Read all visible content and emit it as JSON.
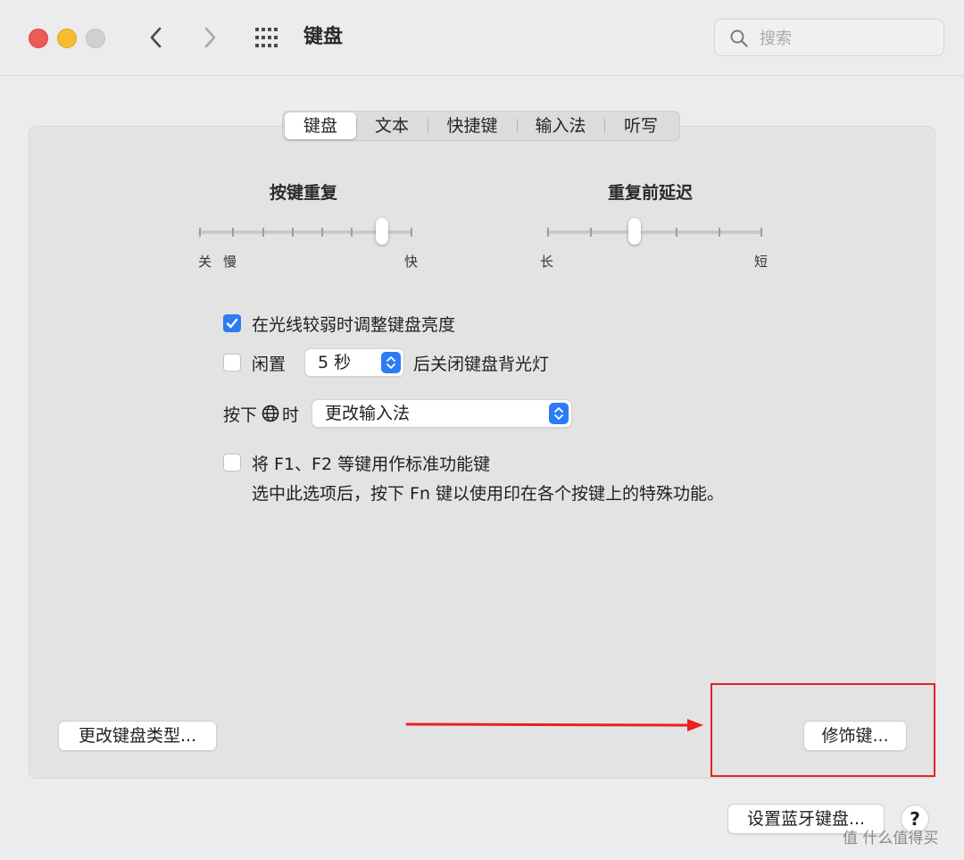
{
  "window": {
    "title": "键盘"
  },
  "search": {
    "placeholder": "搜索"
  },
  "tabs": [
    {
      "label": "键盘",
      "active": true
    },
    {
      "label": "文本",
      "active": false
    },
    {
      "label": "快捷键",
      "active": false
    },
    {
      "label": "输入法",
      "active": false
    },
    {
      "label": "听写",
      "active": false
    }
  ],
  "key_repeat": {
    "title": "按键重复",
    "label_off": "关",
    "label_slow": "慢",
    "label_fast": "快",
    "level_fraction": 0.86
  },
  "delay_until_repeat": {
    "title": "重复前延迟",
    "label_long": "长",
    "label_short": "短",
    "level_fraction": 0.41
  },
  "options": {
    "adjust_brightness": {
      "label": "在光线较弱时调整键盘亮度",
      "checked": true
    },
    "backlight_off": {
      "prefix": "闲置",
      "value": "5 秒",
      "suffix": "后关闭键盘背光灯",
      "checked": false
    },
    "globe_key": {
      "prefix": "按下",
      "suffix": "时",
      "value": "更改输入法"
    },
    "function_keys": {
      "label": "将 F1、F2 等键用作标准功能键",
      "description": "选中此选项后，按下 Fn 键以使用印在各个按键上的特殊功能。",
      "checked": false
    }
  },
  "buttons": {
    "change_keyboard_type": "更改键盘类型...",
    "modifier_keys": "修饰键...",
    "setup_bluetooth": "设置蓝牙键盘...",
    "help": "?"
  },
  "annotation": {
    "highlight_color": "#e8201f"
  },
  "watermark": {
    "text": "值 什么值得买"
  },
  "colors": {
    "accent": "#2c7cf6",
    "close": "#ee5b56",
    "minimize": "#f6be2f"
  }
}
